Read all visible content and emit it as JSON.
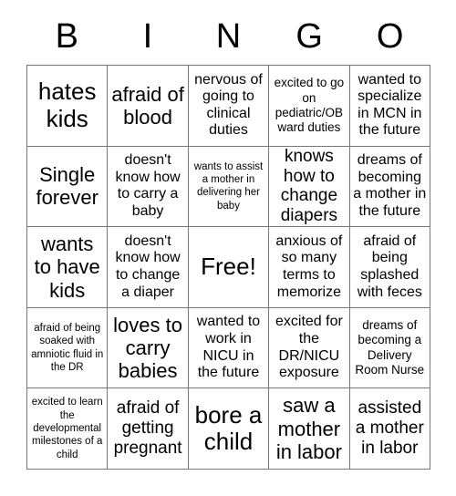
{
  "card": {
    "title": "BINGO",
    "header_letters": [
      "B",
      "I",
      "N",
      "G",
      "O"
    ],
    "free_space_label": "Free!",
    "colors": {
      "text": "#000000",
      "grid_line": "#777777",
      "cell_background": "#ffffff",
      "page_background": "#ffffff"
    },
    "rows": [
      [
        {
          "text": "hates kids",
          "size": "xxl"
        },
        {
          "text": "afraid of blood",
          "size": "xl"
        },
        {
          "text": "nervous of going to clinical duties",
          "size": "md"
        },
        {
          "text": "excited to go on pediatric/OB ward duties",
          "size": "sm"
        },
        {
          "text": "wanted to specialize in MCN in the future",
          "size": "md"
        }
      ],
      [
        {
          "text": "Single forever",
          "size": "xl"
        },
        {
          "text": "doesn't know how to carry a baby",
          "size": "md"
        },
        {
          "text": "wants to assist a mother in delivering her baby",
          "size": "xs"
        },
        {
          "text": "knows how to change diapers",
          "size": "lg"
        },
        {
          "text": "dreams of becoming a mother in the future",
          "size": "md"
        }
      ],
      [
        {
          "text": "wants to have kids",
          "size": "xl"
        },
        {
          "text": "doesn't know how to change a diaper",
          "size": "md"
        },
        {
          "text": "Free!",
          "size": "xxl"
        },
        {
          "text": "anxious of so many terms to memorize",
          "size": "md"
        },
        {
          "text": "afraid of being splashed with feces",
          "size": "md"
        }
      ],
      [
        {
          "text": "afraid of being soaked with amniotic fluid in the DR",
          "size": "xs"
        },
        {
          "text": "loves to carry babies",
          "size": "xl"
        },
        {
          "text": "wanted to work in NICU in the future",
          "size": "md"
        },
        {
          "text": "excited for the DR/NICU exposure",
          "size": "md"
        },
        {
          "text": "dreams of becoming a Delivery Room Nurse",
          "size": "sm"
        }
      ],
      [
        {
          "text": "excited to learn the developmental milestones of a child",
          "size": "xs"
        },
        {
          "text": "afraid of getting pregnant",
          "size": "lg"
        },
        {
          "text": "bore a child",
          "size": "xxl"
        },
        {
          "text": "saw a mother in labor",
          "size": "xl"
        },
        {
          "text": "assisted a mother in labor",
          "size": "lg"
        }
      ]
    ]
  }
}
